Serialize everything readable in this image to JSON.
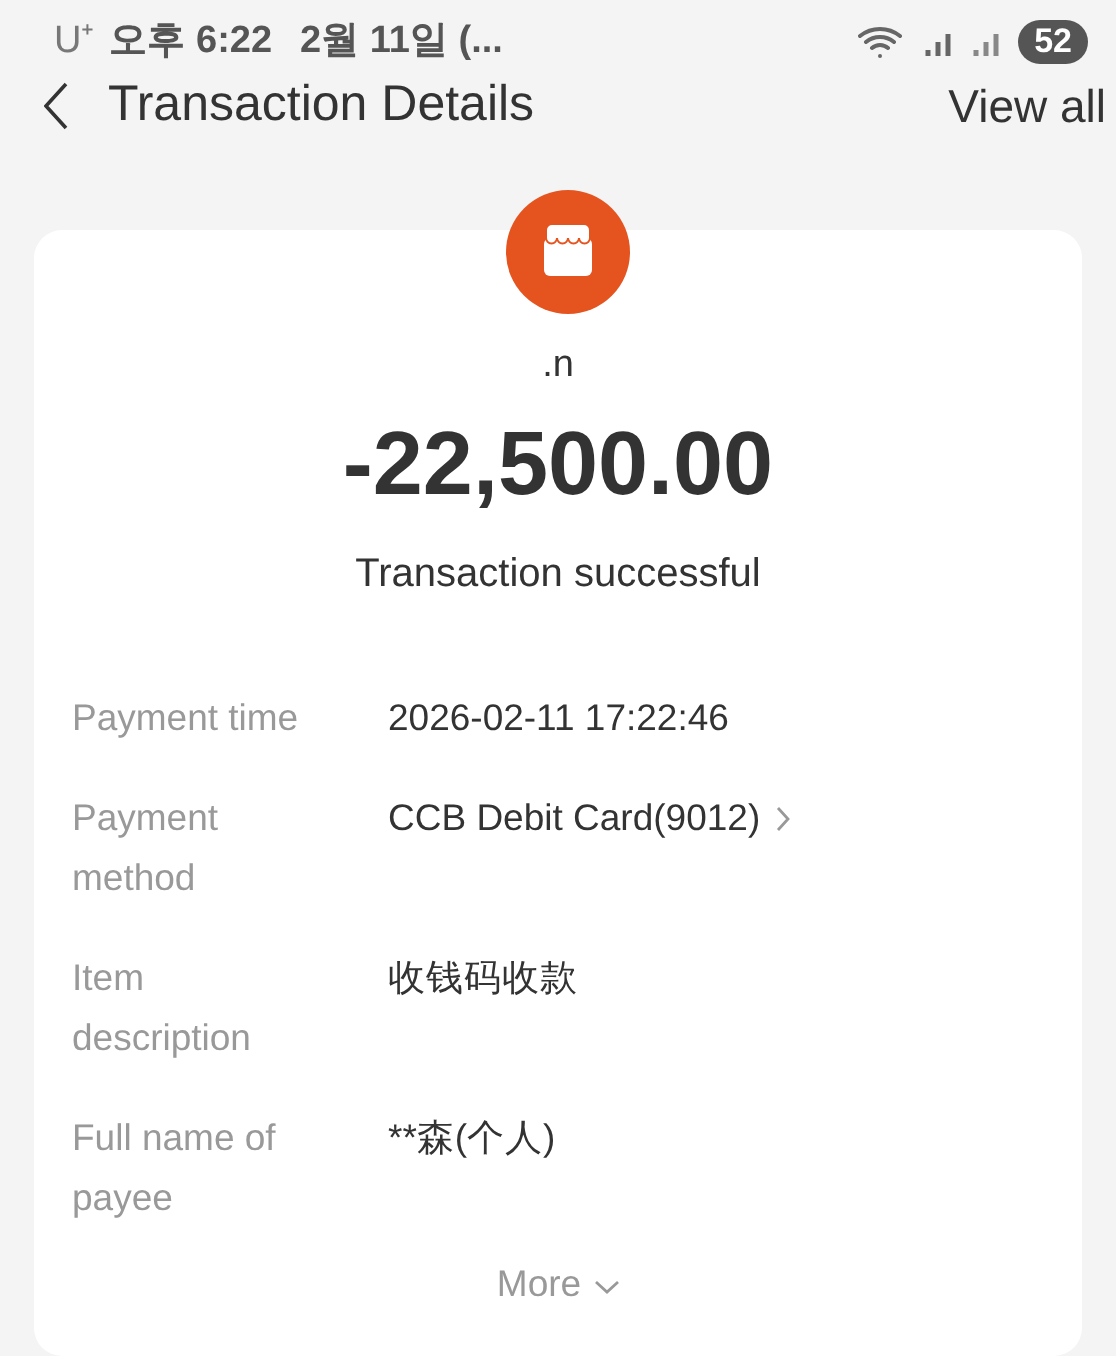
{
  "status_bar": {
    "carrier": "U⁺",
    "time": "오후 6:22",
    "date": "2월 11일 (...",
    "battery": "52"
  },
  "header": {
    "title": "Transaction Details",
    "action": "View all"
  },
  "summary": {
    "merchant": ".n",
    "amount": "-22,500.00",
    "status": "Transaction successful"
  },
  "details": [
    {
      "kind": "text",
      "label": "Payment time",
      "value": "2026-02-11 17:22:46"
    },
    {
      "kind": "link",
      "label": "Payment method",
      "value": "CCB Debit Card(9012)"
    },
    {
      "kind": "text",
      "label": "Item description",
      "value": "收钱码收款"
    },
    {
      "kind": "text",
      "label": "Full name of payee",
      "value": "**森(个人)"
    }
  ],
  "more": "More"
}
